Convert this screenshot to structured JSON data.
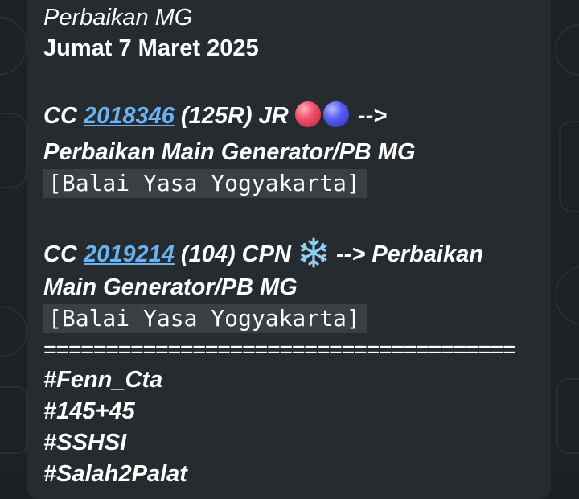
{
  "message": {
    "title": "Perbaikan MG",
    "date": "Jumat 7 Maret 2025",
    "entry1": {
      "prefix": "CC ",
      "link": "2018346",
      "mid": " (125R) JR ",
      "arrow": " -->",
      "line2": "Perbaikan Main Generator/PB MG",
      "location": "[Balai Yasa Yogyakarta]",
      "icons": [
        "red-circle-icon",
        "blue-circle-icon"
      ]
    },
    "entry2": {
      "prefix": "CC ",
      "link": "2019214",
      "mid": " (104) CPN ",
      "arrow": " --> Perbaikan",
      "line2": "Main Generator/PB MG",
      "location": "[Balai Yasa Yogyakarta]",
      "icons": [
        "snowflake-icon"
      ]
    },
    "separator": "======================================",
    "hashtags": [
      "#Fenn_Cta",
      "#145+45",
      "#SSHSI",
      "#Salah2Palat"
    ]
  },
  "colors": {
    "background": "#1d2124",
    "bubble": "#262b2f",
    "link": "#6ab3f3",
    "code_bg": "#3a3f43",
    "text": "#ffffff"
  }
}
